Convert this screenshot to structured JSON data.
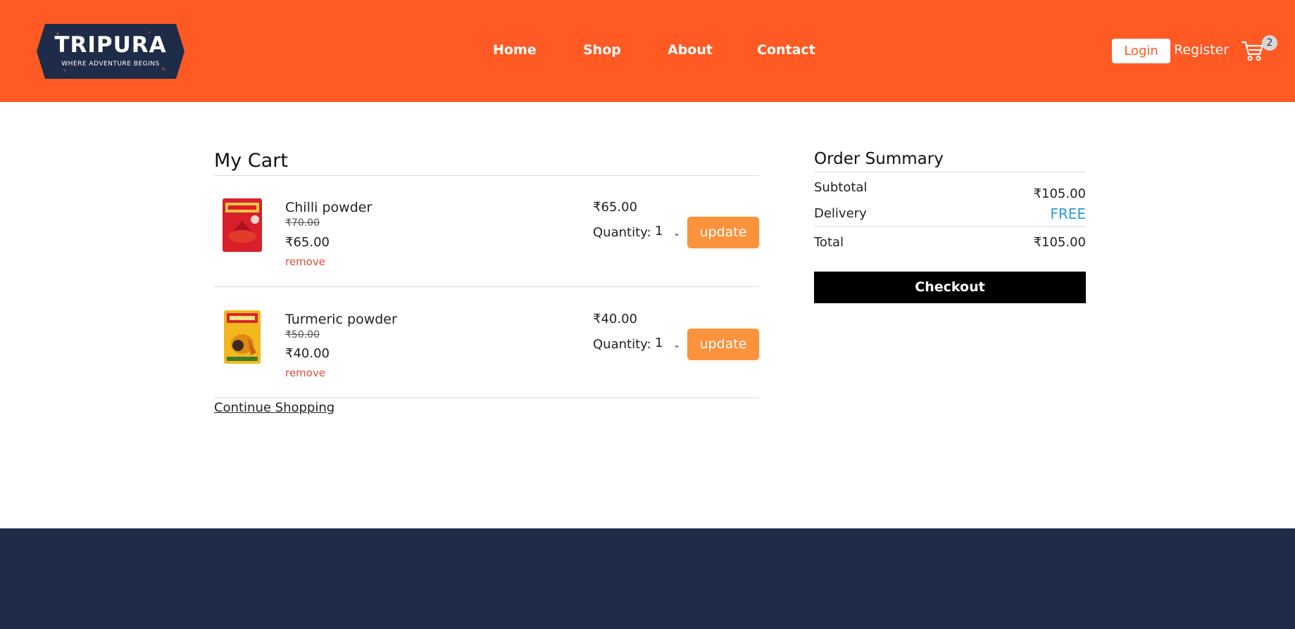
{
  "brand": {
    "title": "TRIPURA",
    "tagline": "WHERE ADVENTURE BEGINS",
    "colors": {
      "header": "#ff5a24",
      "footer": "#1e2c47",
      "update": "#fb923c",
      "remove": "#e04b3c",
      "free": "#2d9cdb"
    }
  },
  "nav": {
    "home": "Home",
    "shop": "Shop",
    "about": "About",
    "contact": "Contact"
  },
  "account": {
    "login": "Login",
    "register": "Register",
    "cart_icon": "cart-icon",
    "cart_count": "2"
  },
  "cart": {
    "title": "My Cart",
    "items": [
      {
        "name": "Chilli powder",
        "old_price": "₹70.00",
        "price": "₹65.00",
        "remove": "remove",
        "line_total": "₹65.00",
        "quantity_label": "Quantity:",
        "quantity": "1",
        "update": "update"
      },
      {
        "name": "Turmeric powder",
        "old_price": "₹50.00",
        "price": "₹40.00",
        "remove": "remove",
        "line_total": "₹40.00",
        "quantity_label": "Quantity:",
        "quantity": "1",
        "update": "update"
      }
    ],
    "continue": "Continue Shopping"
  },
  "summary": {
    "title": "Order Summary",
    "subtotal_label": "Subtotal",
    "subtotal": "₹105.00",
    "delivery_label": "Delivery",
    "delivery": "FREE",
    "total_label": "Total",
    "total": "₹105.00",
    "checkout": "Checkout"
  }
}
